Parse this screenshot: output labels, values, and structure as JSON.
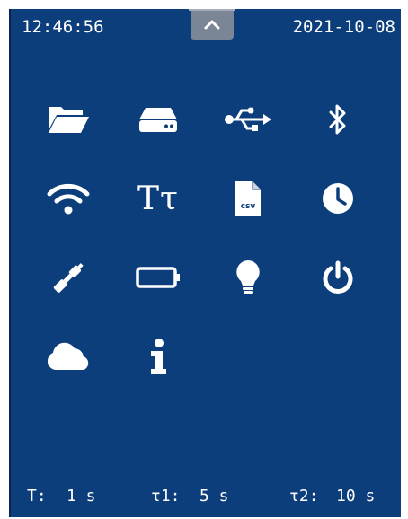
{
  "status_bar": {
    "time": "12:46:56",
    "date": "2021-10-08"
  },
  "menu": {
    "items": [
      {
        "icon": "folder-open-icon"
      },
      {
        "icon": "storage-drive-icon"
      },
      {
        "icon": "usb-icon"
      },
      {
        "icon": "bluetooth-icon"
      },
      {
        "icon": "wifi-icon"
      },
      {
        "icon": "text-format-icon",
        "text": "Tτ"
      },
      {
        "icon": "csv-file-icon",
        "text": "csv"
      },
      {
        "icon": "clock-icon"
      },
      {
        "icon": "probe-icon"
      },
      {
        "icon": "battery-icon"
      },
      {
        "icon": "lightbulb-icon"
      },
      {
        "icon": "power-icon"
      },
      {
        "icon": "cloud-icon"
      },
      {
        "icon": "info-icon"
      }
    ]
  },
  "footer": {
    "t_label": "T:",
    "t_value": "1 s",
    "tau1_label": "τ1:",
    "tau1_value": "5 s",
    "tau2_label": "τ2:",
    "tau2_value": "10 s"
  },
  "colors": {
    "screen_background": "#0c3e7c",
    "icon_color": "#ffffff",
    "tab_color": "#7a8596"
  }
}
